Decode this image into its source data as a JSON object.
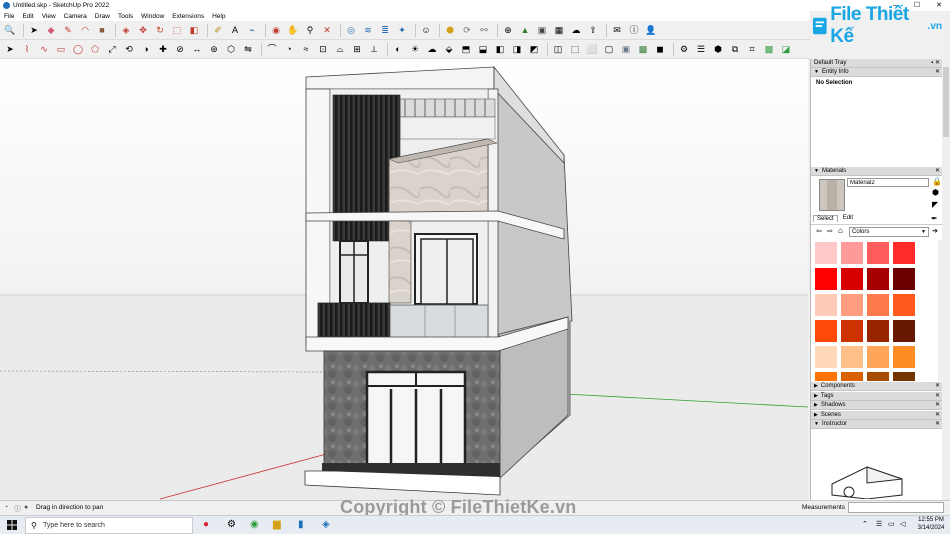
{
  "window": {
    "title": "Untitled.skp - SketchUp Pro 2022",
    "controls": [
      "–",
      "☐",
      "✕"
    ]
  },
  "menu": [
    "File",
    "Edit",
    "View",
    "Camera",
    "Draw",
    "Tools",
    "Window",
    "Extensions",
    "Help"
  ],
  "logo": {
    "text_prefix": "F",
    "text": "ile Thiết Kế",
    "suffix": ".vn"
  },
  "tray": {
    "title": "Default Tray",
    "entity_info": {
      "header": "Entity Info",
      "selection": "No Selection"
    },
    "materials": {
      "header": "Materials",
      "name_value": "Material2",
      "tabs": [
        "Select",
        "Edit"
      ],
      "library": "Colors",
      "swatches": [
        "#ffc9c9",
        "#ff9a9a",
        "#ff5c5c",
        "#ff2a2a",
        "#ff0000",
        "#d60000",
        "#a80000",
        "#6b0000",
        "#ffcbb8",
        "#ff9d7e",
        "#ff7a4a",
        "#ff5a1c",
        "#ff4a0a",
        "#cc3300",
        "#992500",
        "#661800",
        "#ffd8b8",
        "#ffc08a",
        "#ffa65a",
        "#ff8c24",
        "#ff7400",
        "#d96100",
        "#a64b00",
        "#733400"
      ]
    },
    "collapsed_panels": [
      "Components",
      "Tags",
      "Shadows",
      "Scenes",
      "Instructor"
    ]
  },
  "status": {
    "message": "Drag in direction to pan",
    "measurements_label": "Measurements"
  },
  "watermark": "Copyright © FileThietKe.vn",
  "taskbar": {
    "search_placeholder": "Type here to search",
    "time": "12:55 PM",
    "date": "3/14/2024"
  }
}
